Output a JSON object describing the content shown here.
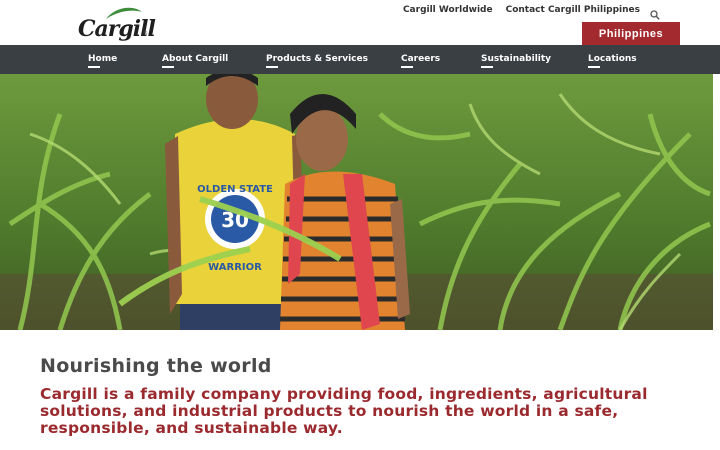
{
  "brand": {
    "logo_text": "Cargill",
    "logo_reg": "®"
  },
  "utility_nav": {
    "worldwide": "Cargill Worldwide",
    "contact": "Contact Cargill Philippines",
    "search_icon": "search-icon"
  },
  "country_selector": {
    "label": "Philippines",
    "color": "#a32a2e"
  },
  "main_nav": {
    "items": [
      {
        "label": "Home"
      },
      {
        "label": "About Cargill"
      },
      {
        "label": "Products & Services"
      },
      {
        "label": "Careers"
      },
      {
        "label": "Sustainability"
      },
      {
        "label": "Locations"
      }
    ],
    "background": "#3a3f44"
  },
  "hero": {
    "shirt_text": "OLDEN STATE",
    "shirt_number": "30",
    "shirt_bottom": "WARRIOR"
  },
  "content": {
    "headline": "Nourishing the world",
    "tagline": "Cargill is a family company providing food, ingredients, agricultural solutions, and industrial products to nourish the world in a safe, responsible, and sustainable way.",
    "accent_color": "#9b2a2f"
  }
}
